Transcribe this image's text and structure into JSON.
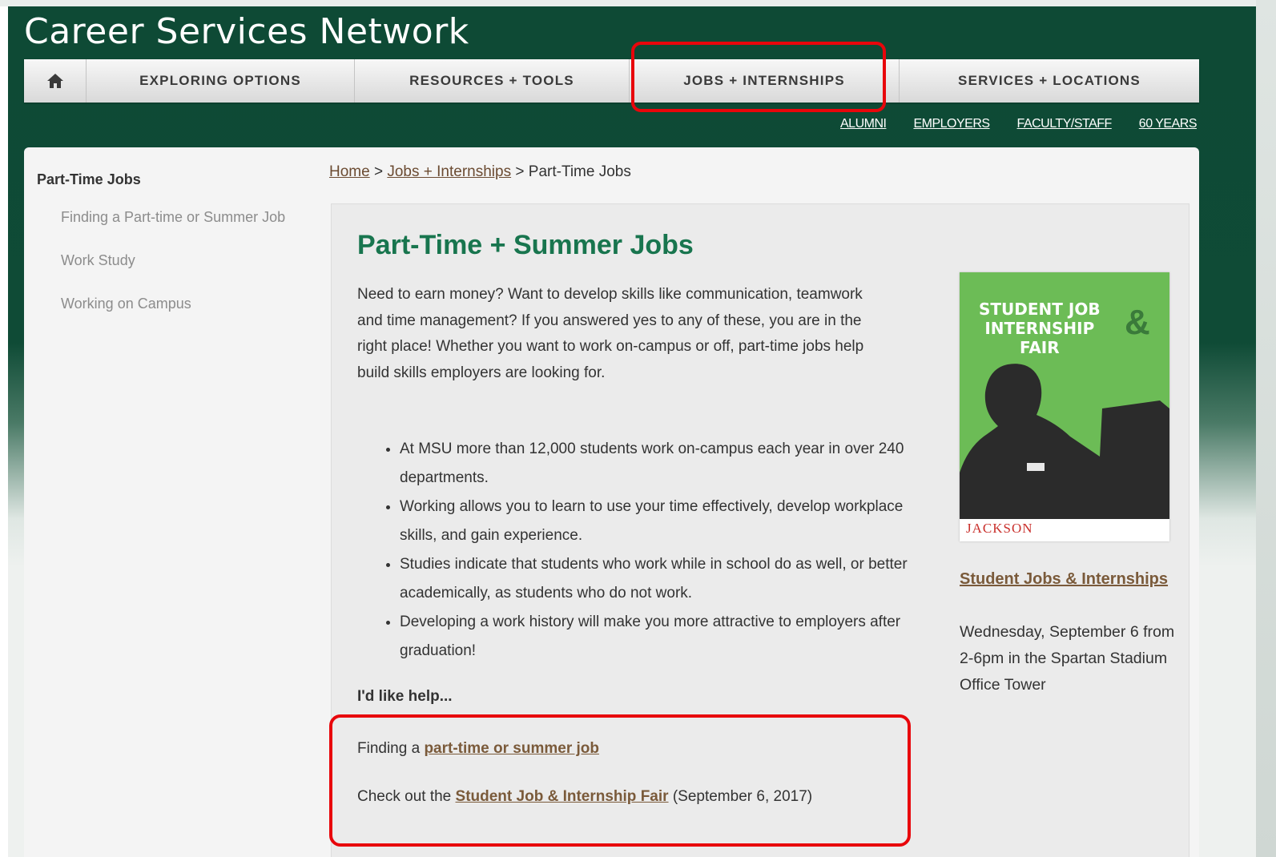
{
  "site": {
    "title": "Career Services Network"
  },
  "nav": {
    "home_icon": "home-icon",
    "items": [
      {
        "label": "EXPLORING OPTIONS"
      },
      {
        "label": "RESOURCES + TOOLS"
      },
      {
        "label": "JOBS + INTERNSHIPS"
      },
      {
        "label": "SERVICES + LOCATIONS"
      }
    ]
  },
  "utility_links": [
    {
      "label": "ALUMNI"
    },
    {
      "label": "EMPLOYERS"
    },
    {
      "label": "FACULTY/STAFF"
    },
    {
      "label": "60 YEARS"
    }
  ],
  "sidebar": {
    "title": "Part-Time Jobs",
    "items": [
      {
        "label": "Finding a Part-time or Summer Job"
      },
      {
        "label": "Work Study"
      },
      {
        "label": "Working on Campus"
      }
    ]
  },
  "breadcrumb": {
    "home": "Home",
    "sep1": ">",
    "section": "Jobs + Internships",
    "sep2": ">",
    "current": "Part-Time Jobs"
  },
  "main": {
    "title": "Part-Time + Summer Jobs",
    "intro": "Need to earn money?  Want to develop skills like communication, teamwork and time management?  If you answered yes to any of these, you are in the right place! Whether you want to work on-campus or off, part-time jobs help build skills employers are looking for.",
    "bullets": [
      "At MSU more than 12,000 students work on-campus each year in over 240 departments.",
      "Working allows you to learn to use your time effectively, develop workplace skills, and gain experience.",
      "Studies indicate that students who work while in school do as well, or better academically, as students who do not work.",
      "Developing a work history will make you more attractive to employers after graduation!"
    ],
    "help_heading": "I'd like help...",
    "help1_prefix": "Finding a",
    "help1_link": "part-time or summer job",
    "help2_prefix": "Check out the",
    "help2_link": "Student Job & Internship Fair",
    "help2_suffix": "(September 6, 2017)"
  },
  "aside": {
    "poster_title_line1": "STUDENT JOB",
    "poster_title_line2": "INTERNSHIP",
    "poster_title_line3": "FAIR",
    "poster_amp": "&",
    "poster_brand": "JACKSON",
    "event_link": "Student Jobs & Internships",
    "event_text": "Wednesday, September 6 from 2-6pm in the Spartan Stadium Office Tower"
  },
  "colors": {
    "brand_green": "#18754e",
    "header_bg": "#0e4a35",
    "link_brown": "#7a5a3a",
    "highlight_red": "#e8060b",
    "poster_green": "#6cbc56"
  }
}
